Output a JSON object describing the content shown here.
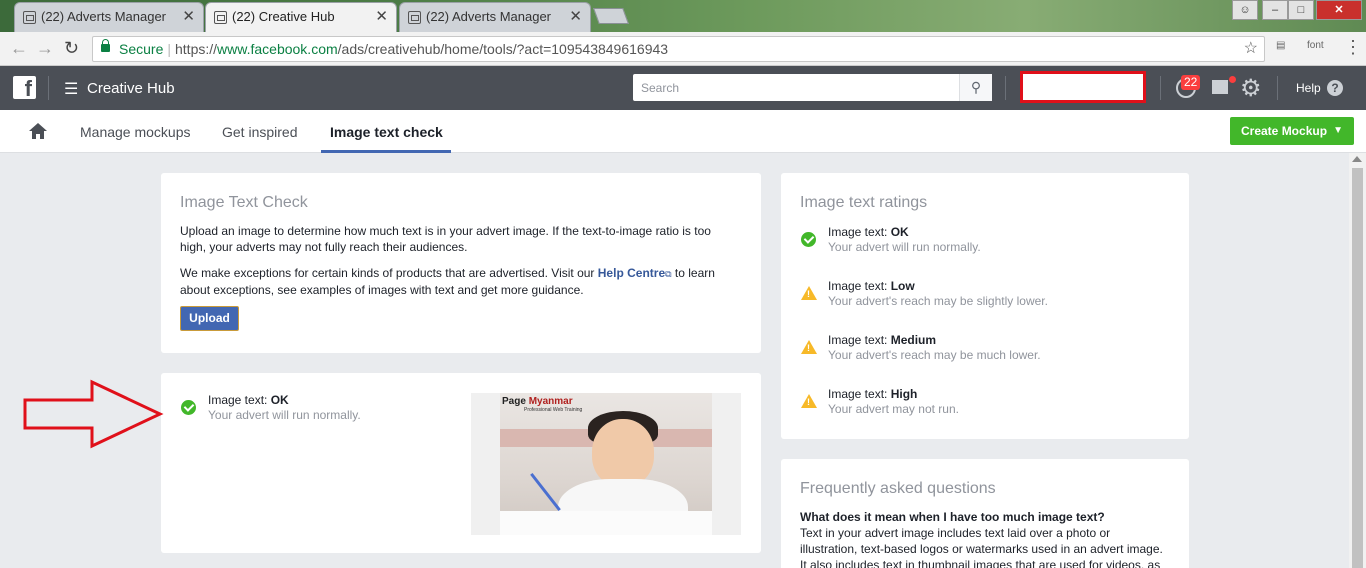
{
  "browser": {
    "tabs": [
      {
        "label": "(22) Adverts Manager",
        "close": "✕"
      },
      {
        "label": "(22) Creative Hub",
        "close": "✕"
      },
      {
        "label": "(22) Adverts Manager",
        "close": "✕"
      }
    ],
    "secure_label": "Secure",
    "url_scheme": "https://",
    "url_host": "www.facebook.com",
    "url_path": "/ads/creativehub/home/tools/?act=109543849616943",
    "ext_font_label": "font"
  },
  "header": {
    "logo_letter": "f",
    "app_title": "Creative Hub",
    "search_placeholder": "Search",
    "notification_count": "22",
    "help_label": "Help",
    "help_glyph": "?"
  },
  "subnav": {
    "tabs": [
      "Manage mockups",
      "Get inspired",
      "Image text check"
    ],
    "create_button": "Create Mockup"
  },
  "check_card": {
    "title": "Image Text Check",
    "para1": "Upload an image to determine how much text is in your advert image. If the text-to-image ratio is too high, your adverts may not fully reach their audiences.",
    "para2_pre": "We make exceptions for certain kinds of products that are advertised. Visit our ",
    "para2_link": "Help Centre",
    "para2_post": " to learn about exceptions, see examples of images with text and get more guidance.",
    "upload_button": "Upload"
  },
  "result_card": {
    "prefix": "Image text: ",
    "level": "OK",
    "desc": "Your advert will run normally.",
    "image_brand": "Page",
    "image_brand2": "Myanmar",
    "image_brand_sub": "Professional Web Training"
  },
  "ratings": {
    "title": "Image text ratings",
    "prefix": "Image text: ",
    "items": [
      {
        "level": "OK",
        "desc": "Your advert will run normally.",
        "status": "ok"
      },
      {
        "level": "Low",
        "desc": "Your advert's reach may be slightly lower.",
        "status": "warning"
      },
      {
        "level": "Medium",
        "desc": "Your advert's reach may be much lower.",
        "status": "warning"
      },
      {
        "level": "High",
        "desc": "Your advert may not run.",
        "status": "warning"
      }
    ]
  },
  "faq": {
    "title": "Frequently asked questions",
    "question": "What does it mean when I have too much image text?",
    "answer": "Text in your advert image includes text laid over a photo or illustration, text-based logos or watermarks used in an advert image. It also includes text in thumbnail images that are used for videos, as"
  },
  "colors": {
    "fb_header": "#4b4f56",
    "accent_blue": "#4267b2",
    "create_green": "#42b72a",
    "annotation_red": "#e0101a",
    "warning_yellow": "#f7b928"
  }
}
